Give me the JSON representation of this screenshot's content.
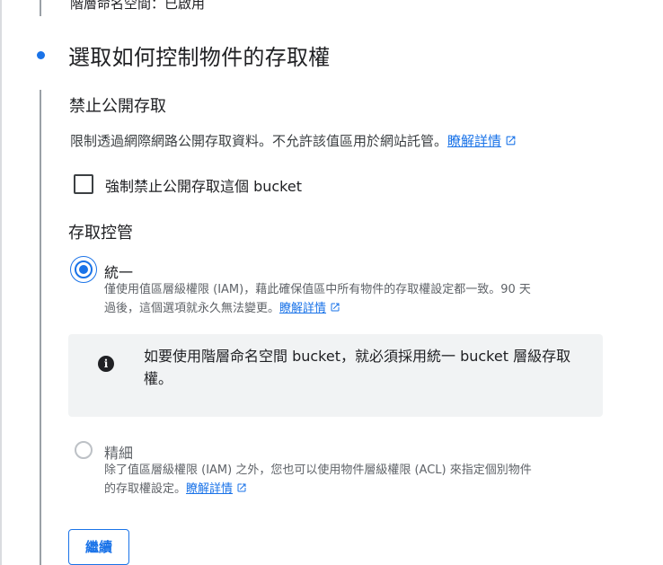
{
  "header": {
    "status_text": "階層命名空間：已啟用",
    "step_title": "選取如何控制物件的存取權"
  },
  "public_access": {
    "heading": "禁止公開存取",
    "description": "限制透過網際網路公開存取資料。不允許該值區用於網站託管。",
    "learn_more": "瞭解詳情",
    "checkbox_label": "強制禁止公開存取這個 bucket",
    "checkbox_checked": false
  },
  "access_control": {
    "heading": "存取控管",
    "uniform": {
      "label": "統一",
      "selected": true,
      "desc_line1": "僅使用值區層級權限 (IAM)，藉此確保值區中所有物件的存取權設定都一致。90 天",
      "desc_line2": "過後，這個選項就永久無法變更。",
      "learn_more": "瞭解詳情"
    },
    "info_note": "如要使用階層命名空間 bucket，就必須採用統一 bucket 層級存取權。",
    "fine_grained": {
      "label": "精細",
      "selected": false,
      "desc_line1": "除了值區層級權限 (IAM) 之外，您也可以使用物件層級權限 (ACL) 來指定個別物件",
      "desc_line2": "的存取權設定。",
      "learn_more": "瞭解詳情"
    }
  },
  "actions": {
    "continue_label": "繼續"
  },
  "colors": {
    "accent": "#1a73e8",
    "note_bg": "#f1f3f4"
  }
}
